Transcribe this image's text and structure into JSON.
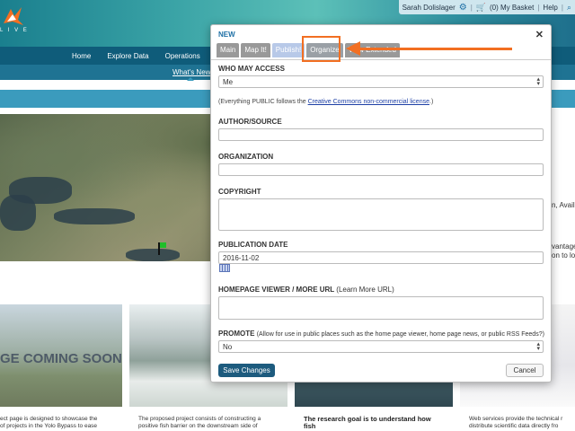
{
  "site": {
    "logo_text": "L I V E",
    "user_name": "Sarah Dolislager",
    "basket_label": "(0) My Basket",
    "help_label": "Help",
    "nav": [
      "Home",
      "Explore Data",
      "Operations"
    ],
    "whats_new": "What's New",
    "right_snippets": [
      "n, Availa",
      "vantage",
      "on to lo"
    ],
    "cards": [
      {
        "coming_soon": "GE COMING SOON",
        "text": "ect page is designed to showcase the\nof projects in the Yolo Bypass to ease"
      },
      {
        "text": "The proposed project consists of constructing a\npositive fish barrier on the downstream side of"
      },
      {
        "text": "The research goal is to understand how\nfish"
      },
      {
        "text": "Web services provide the technical r\ndistribute scientific data directly fro"
      }
    ]
  },
  "modal": {
    "title": "NEW",
    "tabs": [
      "Main",
      "Map It!",
      "Publish!",
      "Organize",
      "View Extended"
    ],
    "who_may_access": {
      "label": "WHO MAY ACCESS",
      "value": "Me"
    },
    "license_note": {
      "prefix": "(Everything PUBLIC follows the ",
      "link": "Creative Commons non-commercial license",
      "suffix": ".)"
    },
    "author": {
      "label": "AUTHOR/SOURCE",
      "value": ""
    },
    "organization": {
      "label": "ORGANIZATION",
      "value": ""
    },
    "copyright": {
      "label": "COPYRIGHT",
      "value": ""
    },
    "publication_date": {
      "label": "PUBLICATION DATE",
      "value": "2016-11-02"
    },
    "homepage_viewer": {
      "label": "HOMEPAGE VIEWER / MORE URL",
      "hint": "(Learn More URL)",
      "value": ""
    },
    "promote": {
      "label": "PROMOTE",
      "hint": "(Allow for use in public places such as the home page viewer, home page news, or public RSS Feeds?)",
      "value": "No"
    },
    "save_label": "Save Changes",
    "cancel_label": "Cancel"
  },
  "colors": {
    "accent": "#f26f22",
    "nav": "#0f5c7a",
    "button": "#1d5b7e"
  }
}
